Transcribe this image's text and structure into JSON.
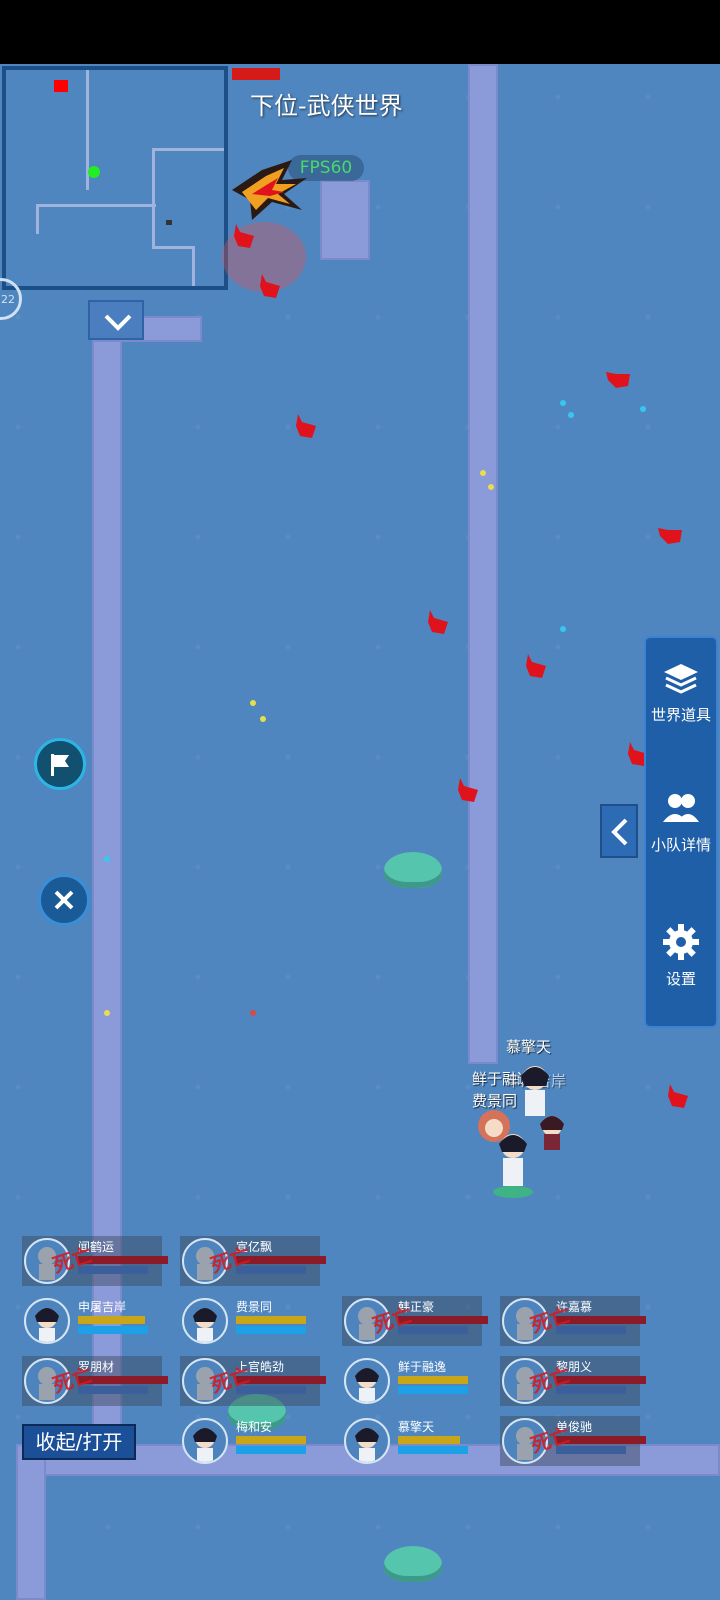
{
  "world": {
    "title": "下位-武侠世界",
    "fps_label": "FPS60"
  },
  "minimap": {
    "badge": "22"
  },
  "side_menu": {
    "items": [
      {
        "label": "世界道具",
        "icon": "layers-icon"
      },
      {
        "label": "小队详情",
        "icon": "team-icon"
      },
      {
        "label": "设置",
        "icon": "gear-icon"
      }
    ]
  },
  "heroes": {
    "labels": [
      "慕擎天",
      "鲜于融逸",
      "申屠吉岸",
      "费景同"
    ]
  },
  "party": [
    {
      "name": "闻鹤运",
      "status": "dead",
      "hp": 0.0,
      "mp": 0.0
    },
    {
      "name": "宣亿飘",
      "status": "dead",
      "hp": 0.0,
      "mp": 0.0
    },
    {
      "name": "申屠吉岸",
      "status": "alive",
      "hp": 0.95,
      "mp": 1.0
    },
    {
      "name": "费景同",
      "status": "alive",
      "hp": 1.0,
      "mp": 1.0
    },
    {
      "name": "韩正豪",
      "status": "dead",
      "hp": 0.0,
      "mp": 0.0
    },
    {
      "name": "许嘉慕",
      "status": "dead",
      "hp": 0.0,
      "mp": 0.0
    },
    {
      "name": "罗朋材",
      "status": "dead",
      "hp": 0.0,
      "mp": 0.0
    },
    {
      "name": "上官皓劲",
      "status": "dead",
      "hp": 0.0,
      "mp": 0.0
    },
    {
      "name": "鲜于融逸",
      "status": "alive",
      "hp": 1.0,
      "mp": 1.0
    },
    {
      "name": "黎朋义",
      "status": "dead",
      "hp": 0.0,
      "mp": 0.0
    },
    {
      "name": "梅和安",
      "status": "alive",
      "hp": 1.0,
      "mp": 1.0
    },
    {
      "name": "慕擎天",
      "status": "alive",
      "hp": 0.88,
      "mp": 1.0
    },
    {
      "name": "单俊驰",
      "status": "dead",
      "hp": 0.0,
      "mp": 0.0
    }
  ],
  "dead_stamp": "死亡",
  "toggle_label": "收起/打开",
  "colors": {
    "water": "#4f86c0",
    "path": "#8b9ad8",
    "panel": "#1f5fa8",
    "enemy": "#e0121b"
  }
}
